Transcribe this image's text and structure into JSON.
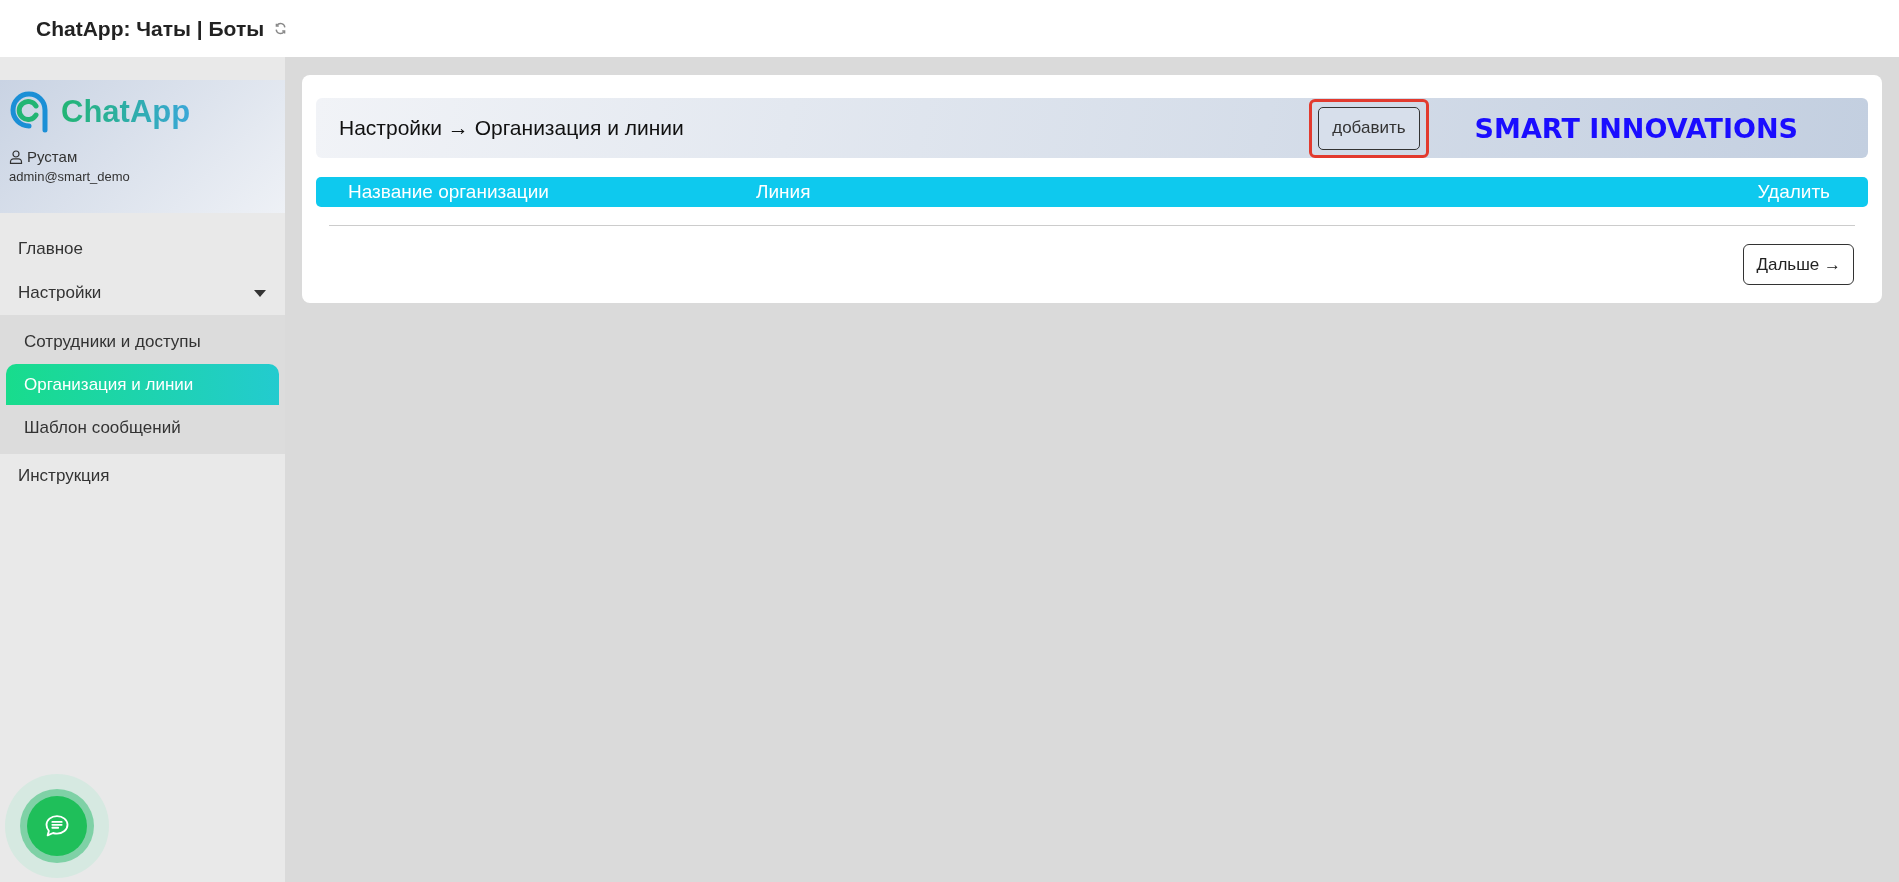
{
  "header": {
    "title": "ChatApp: Чаты | Боты"
  },
  "sidebar": {
    "logo": "ChatApp",
    "user": {
      "name": "Рустам",
      "login": "admin@smart_demo"
    },
    "items": [
      {
        "label": "Главное",
        "selected": false
      },
      {
        "label": "Настройки",
        "selected": false,
        "expanded": true,
        "children": [
          {
            "label": "Сотрудники и доступы",
            "selected": false
          },
          {
            "label": "Организация и линии",
            "selected": true
          },
          {
            "label": "Шаблон сообщений",
            "selected": false
          }
        ]
      },
      {
        "label": "Инструкция",
        "selected": false
      }
    ]
  },
  "content": {
    "breadcrumb": "Настройки → Организация и линии",
    "add_button": {
      "label": "добавить",
      "highlighted": true
    },
    "brand": "SMART INNOVATIONS",
    "table": {
      "columns": [
        "Название организации",
        "Линия",
        "Удалить"
      ]
    },
    "next_button": "Дальше →"
  }
}
